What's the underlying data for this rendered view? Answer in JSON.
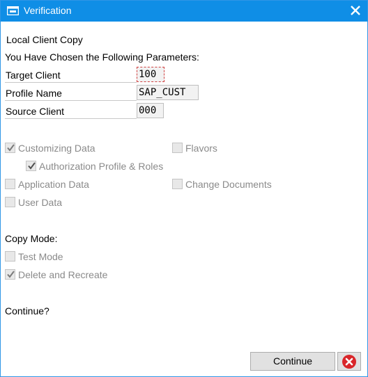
{
  "titlebar": {
    "title": "Verification"
  },
  "content": {
    "heading": "Local Client Copy",
    "subheading": "You Have Chosen the Following Parameters:",
    "params": [
      {
        "label": "Target Client",
        "value": "100"
      },
      {
        "label": "Profile Name",
        "value": "SAP_CUST"
      },
      {
        "label": "Source Client",
        "value": "000"
      }
    ],
    "options": {
      "customizing_data": {
        "label": "Customizing Data",
        "checked": true
      },
      "authorization_profile_roles": {
        "label": "Authorization Profile & Roles",
        "checked": true
      },
      "application_data": {
        "label": "Application Data",
        "checked": false
      },
      "user_data": {
        "label": "User Data",
        "checked": false
      },
      "flavors": {
        "label": "Flavors",
        "checked": false
      },
      "change_documents": {
        "label": "Change Documents",
        "checked": false
      }
    },
    "copy_mode": {
      "heading": "Copy Mode:",
      "test_mode": {
        "label": "Test Mode",
        "checked": false
      },
      "delete_recreate": {
        "label": "Delete and Recreate",
        "checked": true
      }
    },
    "question": "Continue?"
  },
  "buttons": {
    "continue_label": "Continue"
  },
  "colors": {
    "titlebar": "#0f8ee6",
    "cancel_icon": "#d9262a",
    "focus_border": "#d04040"
  },
  "icons": {
    "title": "dialog-window-icon",
    "close": "close-icon",
    "cancel": "cancel-icon",
    "check": "checkmark-icon"
  }
}
